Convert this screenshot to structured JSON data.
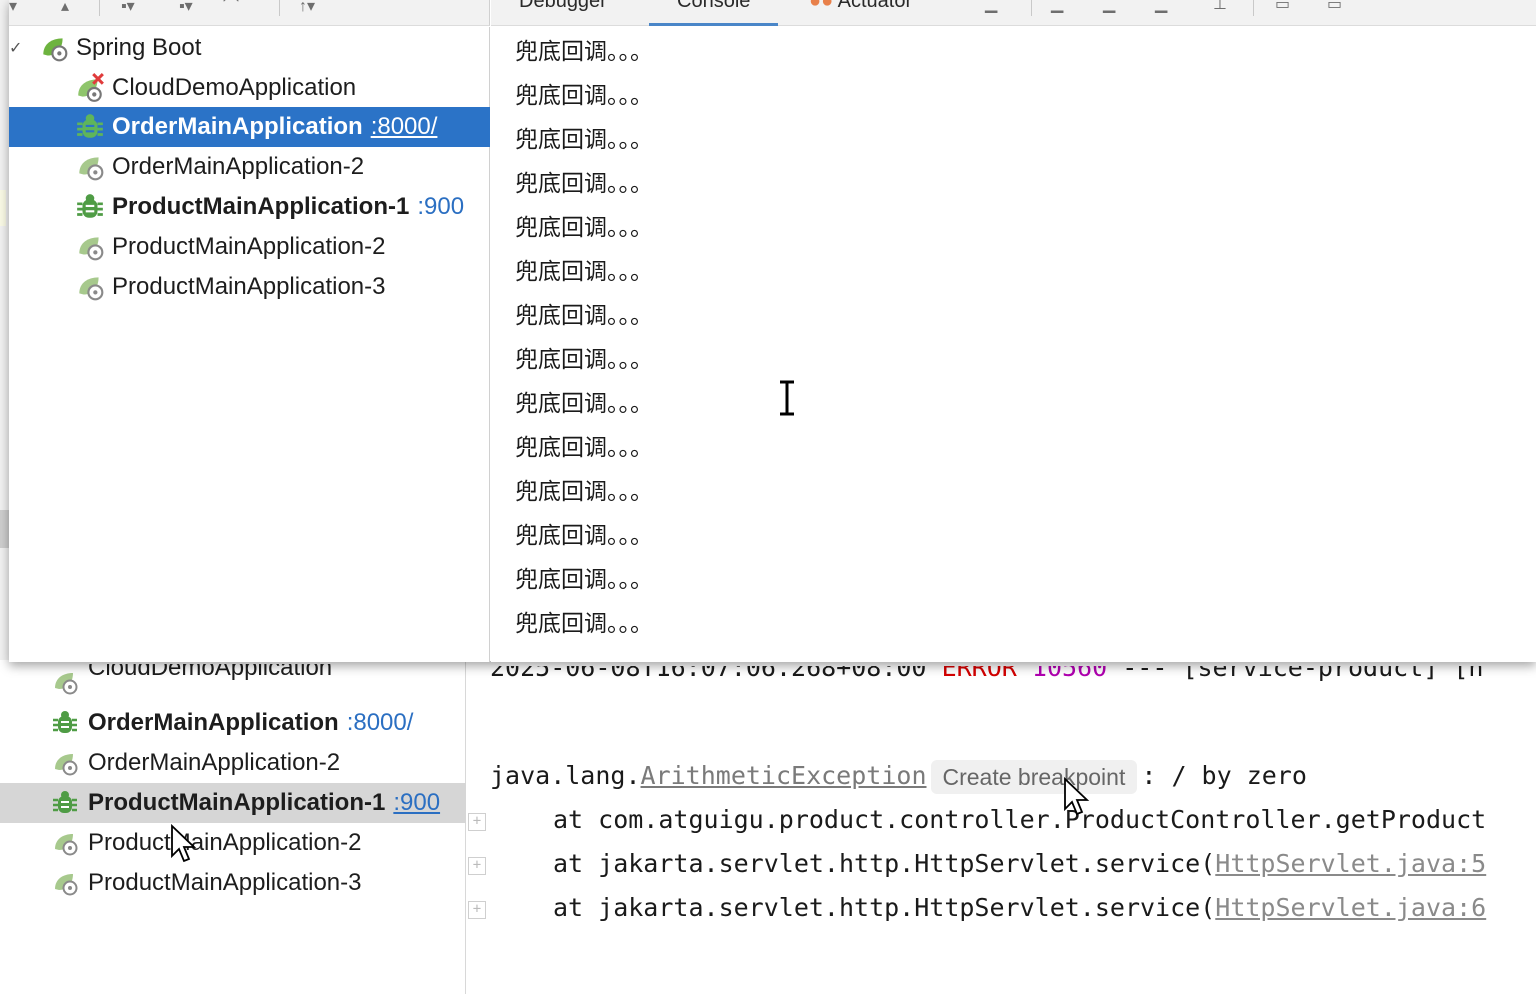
{
  "popup": {
    "tabs": [
      {
        "label": "Debugger"
      },
      {
        "label": "Console",
        "active": true
      },
      {
        "label": "Actuator"
      }
    ],
    "tree": {
      "root": "Spring Boot",
      "items": [
        {
          "name": "CloudDemoApplication",
          "icon": "spring-error-icon",
          "bold": false,
          "port": "",
          "selected": false
        },
        {
          "name": "OrderMainApplication",
          "icon": "bug-icon",
          "bold": true,
          "port": ":8000/",
          "selected": true
        },
        {
          "name": "OrderMainApplication-2",
          "icon": "spring-boot-icon",
          "bold": false,
          "port": "",
          "selected": false
        },
        {
          "name": "ProductMainApplication-1",
          "icon": "bug-icon",
          "bold": true,
          "port": ":900",
          "selected": false
        },
        {
          "name": "ProductMainApplication-2",
          "icon": "spring-boot-icon",
          "bold": false,
          "port": "",
          "selected": false
        },
        {
          "name": "ProductMainApplication-3",
          "icon": "spring-boot-icon",
          "bold": false,
          "port": "",
          "selected": false
        }
      ]
    },
    "console_lines": [
      "兜底回调。。。",
      "兜底回调。。。",
      "兜底回调。。。",
      "兜底回调。。。",
      "兜底回调。。。",
      "兜底回调。。。",
      "兜底回调。。。",
      "兜底回调。。。",
      "兜底回调。。。",
      "兜底回调。。。",
      "兜底回调。。。",
      "兜底回调。。。",
      "兜底回调。。。",
      "兜底回调。。。"
    ]
  },
  "background": {
    "tree": {
      "items": [
        {
          "name": "CloudDemoApplication",
          "icon": "spring-boot-icon",
          "bold": false,
          "port": "",
          "selected": false
        },
        {
          "name": "OrderMainApplication",
          "icon": "bug-icon",
          "bold": true,
          "port": ":8000/",
          "selected": false
        },
        {
          "name": "OrderMainApplication-2",
          "icon": "spring-boot-icon",
          "bold": false,
          "port": "",
          "selected": false
        },
        {
          "name": "ProductMainApplication-1",
          "icon": "bug-icon",
          "bold": true,
          "port": ":900",
          "selected": true
        },
        {
          "name": "ProductMainApplication-2",
          "icon": "spring-boot-icon",
          "bold": false,
          "port": "",
          "selected": false
        },
        {
          "name": "ProductMainApplication-3",
          "icon": "spring-boot-icon",
          "bold": false,
          "port": "",
          "selected": false
        }
      ]
    },
    "console": {
      "log_timestamp": "2025-06-08T16:07:06.268+08:00",
      "log_level": "ERROR",
      "log_pid": "10560",
      "log_sep": "---",
      "log_thread": "[service-product] [n",
      "exception_package": "java.lang.",
      "exception_class": "ArithmeticException",
      "create_breakpoint": "Create breakpoint",
      "exception_message": ": / by zero",
      "stack": [
        {
          "text": "at com.atguigu.product.controller.ProductController.getProduct",
          "link": ""
        },
        {
          "text": "at jakarta.servlet.http.HttpServlet.service(",
          "link": "HttpServlet.java:5"
        },
        {
          "text": "at jakarta.servlet.http.HttpServlet.service(",
          "link": "HttpServlet.java:6"
        }
      ]
    }
  },
  "colors": {
    "selection_blue": "#2b73c7",
    "port_blue": "#2b6fc2",
    "error_red": "#d40000",
    "pid_magenta": "#b000b0",
    "spring_green": "#6db33f"
  }
}
